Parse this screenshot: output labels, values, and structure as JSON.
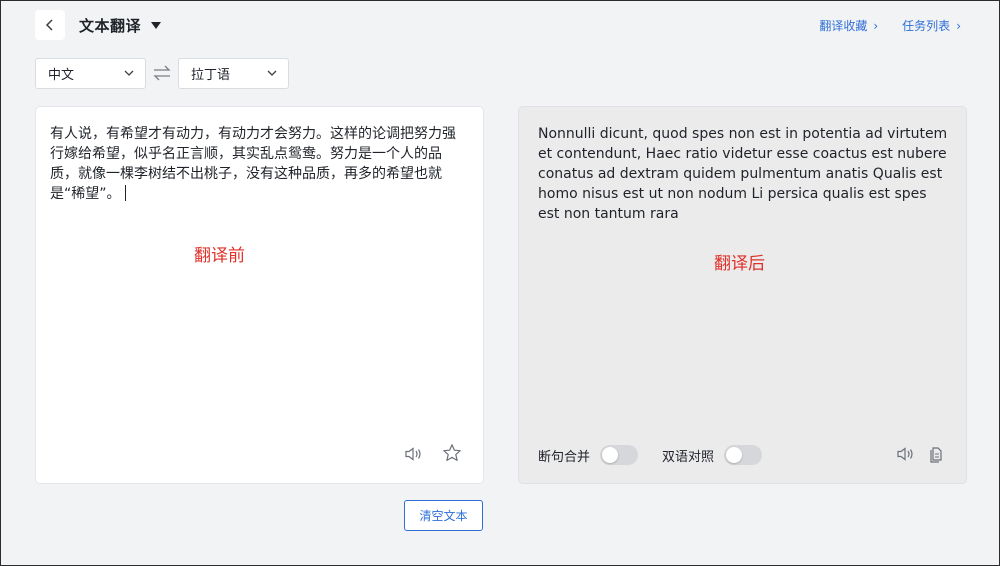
{
  "header": {
    "title": "文本翻译",
    "links": [
      {
        "label": "翻译收藏",
        "chevron": "›"
      },
      {
        "label": "任务列表",
        "chevron": "›"
      }
    ]
  },
  "languages": {
    "source": "中文",
    "target": "拉丁语"
  },
  "source_panel": {
    "text": "有人说，有希望才有动力，有动力才会努力。这样的论调把努力强行嫁给希望，似乎名正言顺，其实乱点鸳鸯。努力是一个人的品质，就像一棵李树结不出桃子，没有这种品质，再多的希望也就是“稀望”。",
    "marker": "翻译前"
  },
  "target_panel": {
    "text": "Nonnulli dicunt, quod spes non est in potentia ad virtutem et contendunt, Haec ratio videtur esse coactus est nubere conatus ad dextram quidem pulmentum anatis Qualis est homo nisus est ut non nodum Li persica qualis est spes est non tantum rara",
    "marker": "翻译后",
    "toggles": [
      {
        "label": "断句合并",
        "on": false
      },
      {
        "label": "双语对照",
        "on": false
      }
    ]
  },
  "actions": {
    "clear_label": "清空文本"
  },
  "colors": {
    "accent": "#2f6fd6",
    "marker": "#e0302a"
  }
}
